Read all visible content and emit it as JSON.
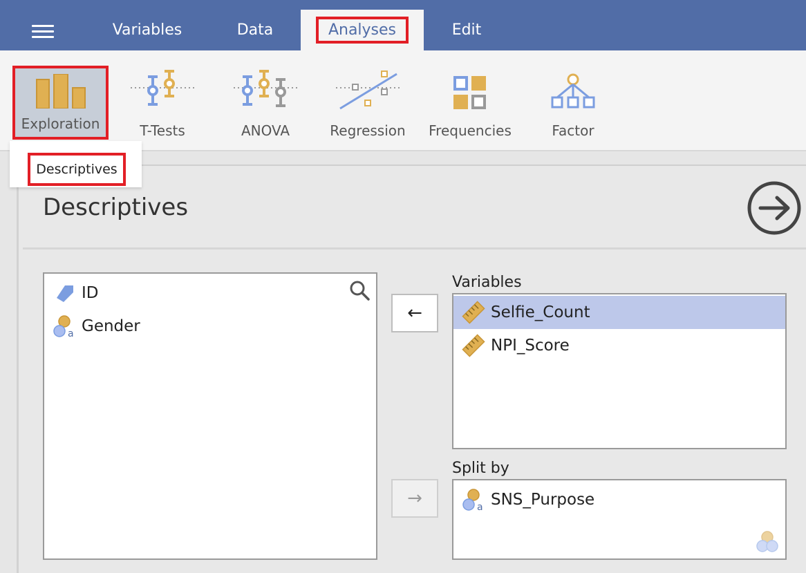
{
  "top_tabs": {
    "menu_icon": "hamburger-menu-icon",
    "tabs": [
      {
        "label": "Variables"
      },
      {
        "label": "Data"
      },
      {
        "label": "Analyses",
        "active": true
      },
      {
        "label": "Edit"
      }
    ]
  },
  "ribbon": {
    "buttons": [
      {
        "label": "Exploration",
        "icon": "exploration-bars-icon",
        "active": true
      },
      {
        "label": "T-Tests",
        "icon": "t-tests-icon"
      },
      {
        "label": "ANOVA",
        "icon": "anova-icon"
      },
      {
        "label": "Regression",
        "icon": "regression-icon"
      },
      {
        "label": "Frequencies",
        "icon": "frequencies-grid-icon"
      },
      {
        "label": "Factor",
        "icon": "factor-tree-icon"
      }
    ]
  },
  "dropdown": {
    "items": [
      {
        "label": "Descriptives"
      }
    ]
  },
  "analysis": {
    "title": "Descriptives",
    "run_icon": "arrow-right-circle-icon",
    "available": {
      "search_icon": "search-icon",
      "items": [
        {
          "label": "ID",
          "icon": "id-tag-icon"
        },
        {
          "label": "Gender",
          "icon": "nominal-variable-icon"
        }
      ]
    },
    "variables": {
      "label": "Variables",
      "items": [
        {
          "label": "Selfie_Count",
          "icon": "ruler-icon",
          "selected": true
        },
        {
          "label": "NPI_Score",
          "icon": "ruler-icon"
        }
      ]
    },
    "split_by": {
      "label": "Split by",
      "items": [
        {
          "label": "SNS_Purpose",
          "icon": "nominal-variable-icon"
        }
      ],
      "footer_icon": "nominal-multi-icon"
    },
    "move_left_symbol": "←",
    "move_right_symbol": "→"
  },
  "colors": {
    "accent": "#516da7",
    "highlight_border": "#e21f26",
    "selected_row": "#bdc8ea",
    "icon_blue": "#7b9de0",
    "icon_gold": "#e0b052"
  }
}
